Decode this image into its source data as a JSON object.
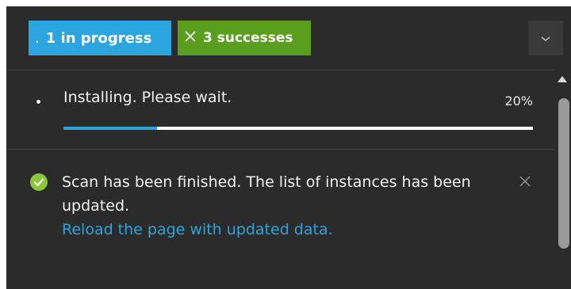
{
  "header": {
    "in_progress_badge": {
      "glyph": ".",
      "label": "1 in progress",
      "color": "#2aa5df"
    },
    "successes_badge": {
      "icon": "close-icon",
      "label": "3 successes",
      "color": "#5a9e1e"
    },
    "collapse_button": {
      "icon": "chevron-down-icon"
    }
  },
  "notifications": {
    "progress_item": {
      "text": "Installing. Please wait.",
      "percent_label": "20%",
      "progress": 0.2,
      "accent": "#2aa5df"
    },
    "success_item": {
      "icon": "check-circle-icon",
      "message": "Scan has been finished. The list of instances has been updated.",
      "link": "Reload the page with updated data.",
      "close_icon": "close-icon"
    }
  }
}
